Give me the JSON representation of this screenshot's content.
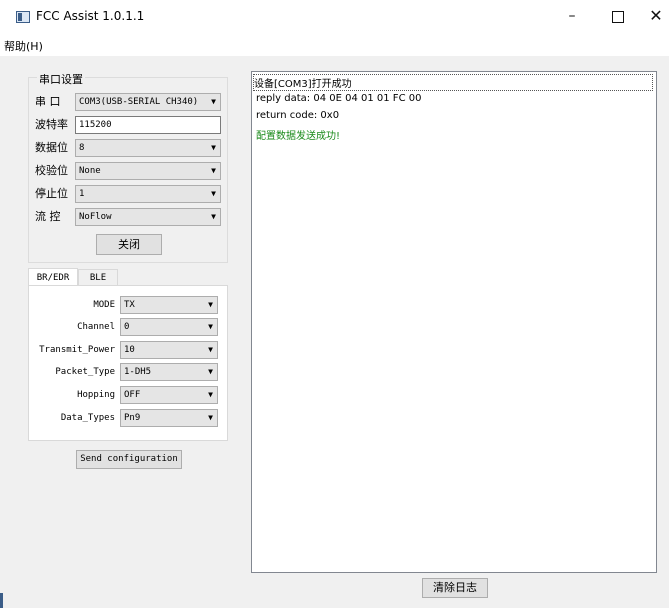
{
  "window": {
    "title": "FCC Assist 1.0.1.1",
    "min": "–",
    "close": "✕"
  },
  "menu": {
    "help": "帮助(H)"
  },
  "serial": {
    "legend": "串口设置",
    "port_label": "串  口",
    "port_value": "COM3(USB-SERIAL CH340)",
    "baud_label": "波特率",
    "baud_value": "115200",
    "databits_label": "数据位",
    "databits_value": "8",
    "parity_label": "校验位",
    "parity_value": "None",
    "stopbits_label": "停止位",
    "stopbits_value": "1",
    "flow_label": "流  控",
    "flow_value": "NoFlow",
    "close_button": "关闭"
  },
  "tabs": [
    {
      "label": "BR/EDR"
    },
    {
      "label": "BLE"
    }
  ],
  "params": [
    {
      "label": "MODE",
      "value": "TX"
    },
    {
      "label": "Channel",
      "value": "0"
    },
    {
      "label": "Transmit_Power",
      "value": "10"
    },
    {
      "label": "Packet_Type",
      "value": "1-DH5"
    },
    {
      "label": "Hopping",
      "value": "OFF"
    },
    {
      "label": "Data_Types",
      "value": "Pn9"
    }
  ],
  "send_button": "Send configuration",
  "log": [
    {
      "text": "设备[COM3]打开成功"
    },
    {
      "text": "reply data: 04 0E 04 01 01 FC 00"
    },
    {
      "text": "return code: 0x0"
    },
    {
      "text": "配置数据发送成功!"
    }
  ],
  "clear_button": "清除日志",
  "colors": {
    "success": "#1a8a1a",
    "accent": "#3b5d88"
  },
  "icons": {
    "combo_arrow": "▼"
  }
}
